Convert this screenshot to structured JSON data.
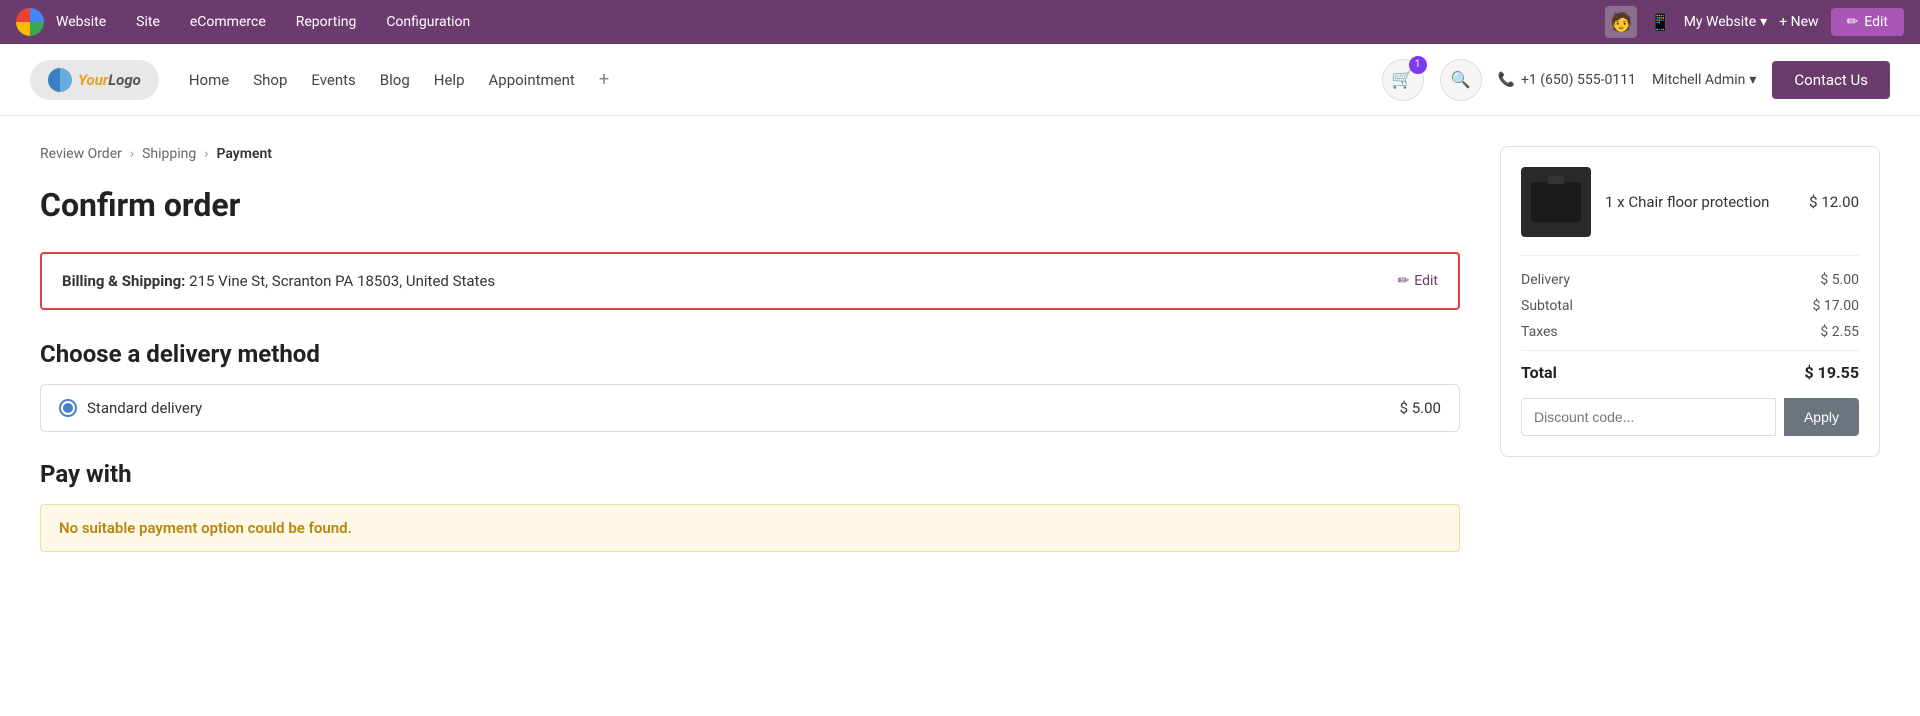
{
  "admin_bar": {
    "logo_text": "Website",
    "nav_items": [
      "Site",
      "eCommerce",
      "Reporting",
      "Configuration"
    ],
    "my_website_label": "My Website",
    "new_label": "+ New",
    "edit_label": "Edit"
  },
  "website_nav": {
    "logo_text": "YourLogo",
    "nav_links": [
      "Home",
      "Shop",
      "Events",
      "Blog",
      "Help",
      "Appointment"
    ],
    "cart_count": "1",
    "phone": "+1 (650) 555-0111",
    "user": "Mitchell Admin",
    "contact_btn": "Contact Us"
  },
  "breadcrumb": {
    "items": [
      "Review Order",
      "Shipping",
      "Payment"
    ]
  },
  "page": {
    "title": "Confirm order",
    "billing_label": "Billing & Shipping:",
    "billing_address": "215 Vine St, Scranton PA 18503, United States",
    "edit_link": "Edit",
    "delivery_section": "Choose a delivery method",
    "delivery_option": "Standard delivery",
    "delivery_price": "$ 5.00",
    "pay_section": "Pay with",
    "no_payment_msg": "No suitable payment option could be found."
  },
  "order_summary": {
    "product_qty": "1 x",
    "product_name": "Chair floor protection",
    "product_price": "$ 12.00",
    "delivery_label": "Delivery",
    "delivery_value": "$ 5.00",
    "subtotal_label": "Subtotal",
    "subtotal_value": "$ 17.00",
    "taxes_label": "Taxes",
    "taxes_value": "$ 2.55",
    "total_label": "Total",
    "total_value": "$ 19.55",
    "discount_placeholder": "Discount code...",
    "apply_label": "Apply"
  }
}
